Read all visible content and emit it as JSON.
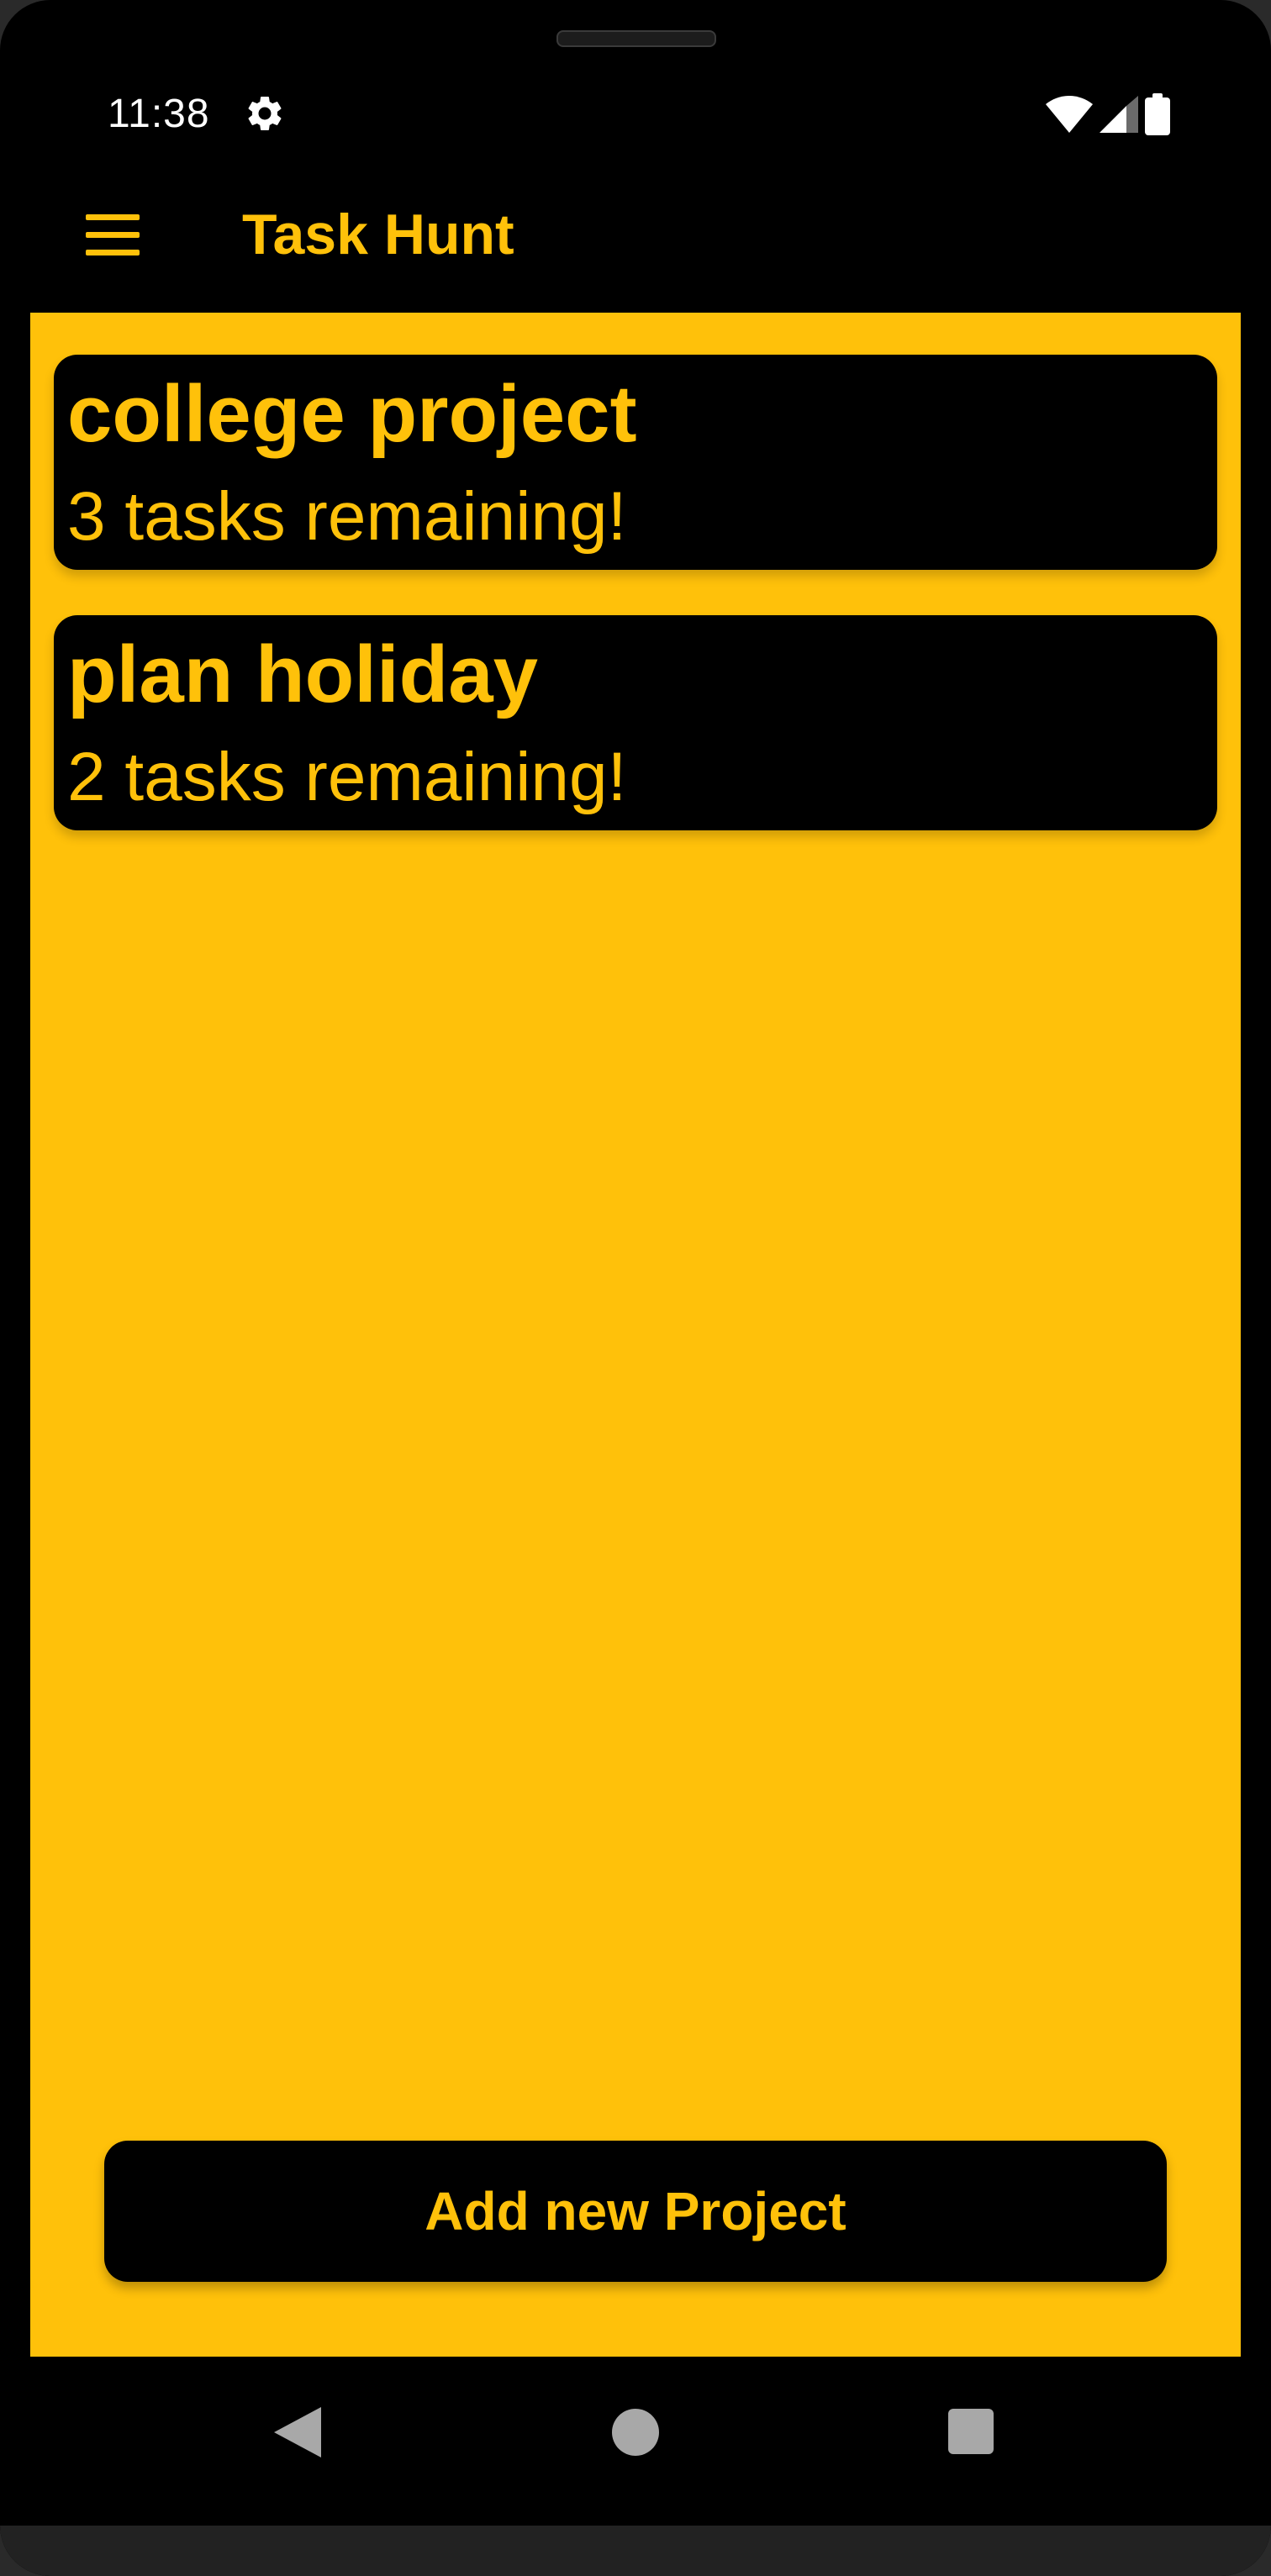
{
  "status_bar": {
    "time": "11:38",
    "icons": [
      "gear-icon",
      "wifi-icon",
      "cell-signal-icon",
      "battery-icon"
    ]
  },
  "app_bar": {
    "menu_icon": "menu-icon",
    "title": "Task Hunt"
  },
  "projects": [
    {
      "name": "college project",
      "tasks_label": "3 tasks remaining!"
    },
    {
      "name": "plan holiday",
      "tasks_label": "2 tasks remaining!"
    }
  ],
  "add_button": {
    "label": "Add new Project"
  },
  "nav_bar": {
    "icons": [
      "back-icon",
      "home-icon",
      "recents-icon"
    ]
  },
  "colors": {
    "accent": "#FFC10A",
    "background": "#000000",
    "nav_icon": "#A8A8A8"
  }
}
